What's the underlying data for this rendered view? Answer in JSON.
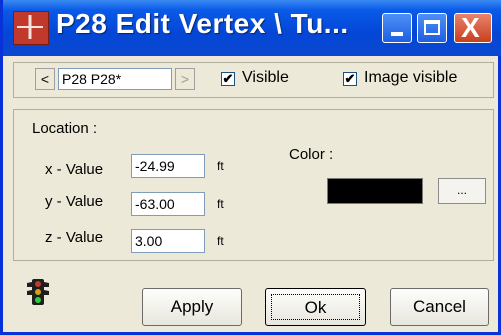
{
  "window": {
    "title": "P28 Edit Vertex \\ Tu...",
    "app_icon": "fase-app-icon",
    "minimize_icon": "minimize-icon",
    "maximize_icon": "maximize-icon",
    "close_glyph": "X"
  },
  "navigator": {
    "prev_glyph": "<",
    "next_glyph": ">",
    "current_value": "P28 P28*"
  },
  "options": {
    "visible": {
      "label": "Visible",
      "checked": true,
      "mark": "✔"
    },
    "image_visible": {
      "label": "Image visible",
      "checked": true,
      "mark": "✔"
    }
  },
  "location": {
    "label": "Location :",
    "x": {
      "label": "x - Value",
      "value": "-24.99",
      "unit": "ft"
    },
    "y": {
      "label": "y - Value",
      "value": "-63.00",
      "unit": "ft"
    },
    "z": {
      "label": "z - Value",
      "value": "3.00",
      "unit": "ft"
    }
  },
  "color": {
    "label": "Color :",
    "value": "#000000",
    "picker_label": "..."
  },
  "footer": {
    "status_icon": "traffic-light-icon",
    "apply_label": "Apply",
    "ok_label": "Ok",
    "cancel_label": "Cancel"
  }
}
